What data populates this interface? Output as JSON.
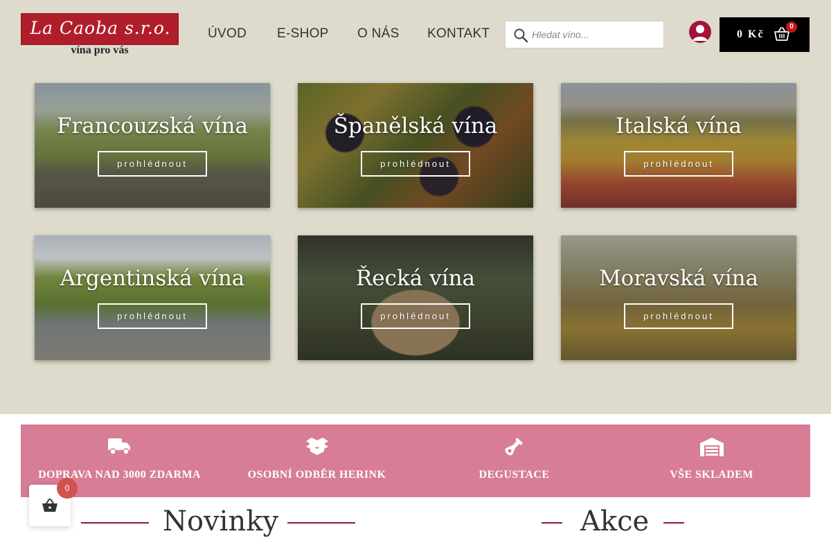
{
  "header": {
    "logo_text": "La Caoba s.r.o.",
    "tagline": "vína pro vás",
    "nav": [
      "ÚVOD",
      "E-SHOP",
      "O NÁS",
      "KONTAKT"
    ],
    "search_placeholder": "Hledat víno...",
    "cart_amount": "0 Kč",
    "cart_count": "0"
  },
  "tiles": [
    {
      "title": "Francouzská vína",
      "button": "prohlédnout"
    },
    {
      "title": "Španělská vína",
      "button": "prohlédnout"
    },
    {
      "title": "Italská vína",
      "button": "prohlédnout"
    },
    {
      "title": "Argentinská vína",
      "button": "prohlédnout"
    },
    {
      "title": "Řecká vína",
      "button": "prohlédnout"
    },
    {
      "title": "Moravská vína",
      "button": "prohlédnout"
    }
  ],
  "features": [
    {
      "label": "DOPRAVA NAD 3000 ZDARMA",
      "icon": "truck-icon"
    },
    {
      "label": "OSOBNÍ ODBĚR HERINK",
      "icon": "box-icon"
    },
    {
      "label": "DEGUSTACE",
      "icon": "wine-bottle-icon"
    },
    {
      "label": "VŠE SKLADEM",
      "icon": "warehouse-icon"
    }
  ],
  "sections": {
    "novinky": "Novinky",
    "akce": "Akce"
  },
  "floating_basket": {
    "count": "0"
  },
  "colors": {
    "background": "#dedbcc",
    "logo_red": "#b11e2b",
    "accent_pink": "#d77d96",
    "accent_maroon": "#8c1b37",
    "cart_black": "#000000",
    "user_icon": "#a3123e"
  }
}
